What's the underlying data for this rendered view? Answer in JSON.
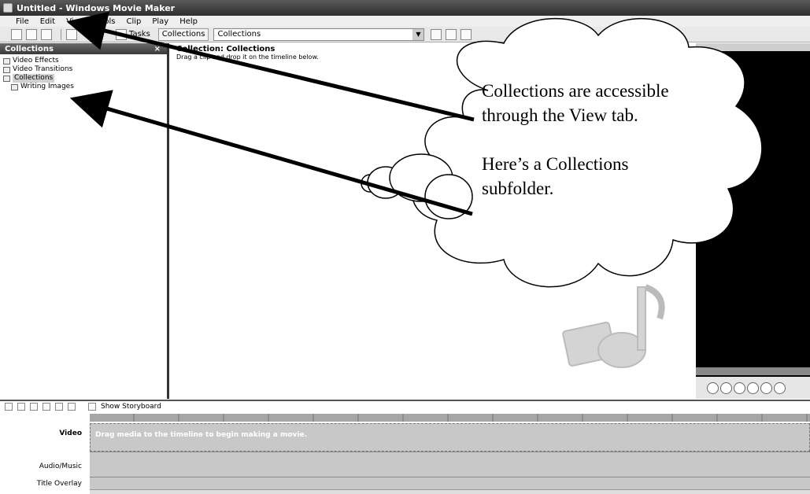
{
  "window": {
    "title": "Untitled - Windows Movie Maker"
  },
  "menu": [
    "File",
    "Edit",
    "View",
    "Tools",
    "Clip",
    "Play",
    "Help"
  ],
  "toolbar": {
    "tasks_label": "Tasks",
    "collections_button_label": "Collections",
    "collections_select_value": "Collections"
  },
  "left_panel": {
    "title": "Collections",
    "close_glyph": "×",
    "items": [
      {
        "label": "Video Effects",
        "icon": "star-icon"
      },
      {
        "label": "Video Transitions",
        "icon": "transition-icon"
      },
      {
        "label": "Collections",
        "icon": "folder-icon"
      },
      {
        "label": "Writing Images",
        "icon": "folder-icon"
      }
    ]
  },
  "content": {
    "title": "Collection: Collections",
    "subtitle": "Drag a clip and drop it on the timeline below."
  },
  "timeline": {
    "show_storyboard_label": "Show Storyboard",
    "tracks": {
      "video": "Video",
      "audio": "Audio/Music",
      "title": "Title Overlay"
    },
    "video_hint": "Drag media to the timeline to begin making a movie."
  },
  "callout": {
    "line1": "Collections are accessible through the View tab.",
    "line2": "Here’s a Collections subfolder."
  }
}
